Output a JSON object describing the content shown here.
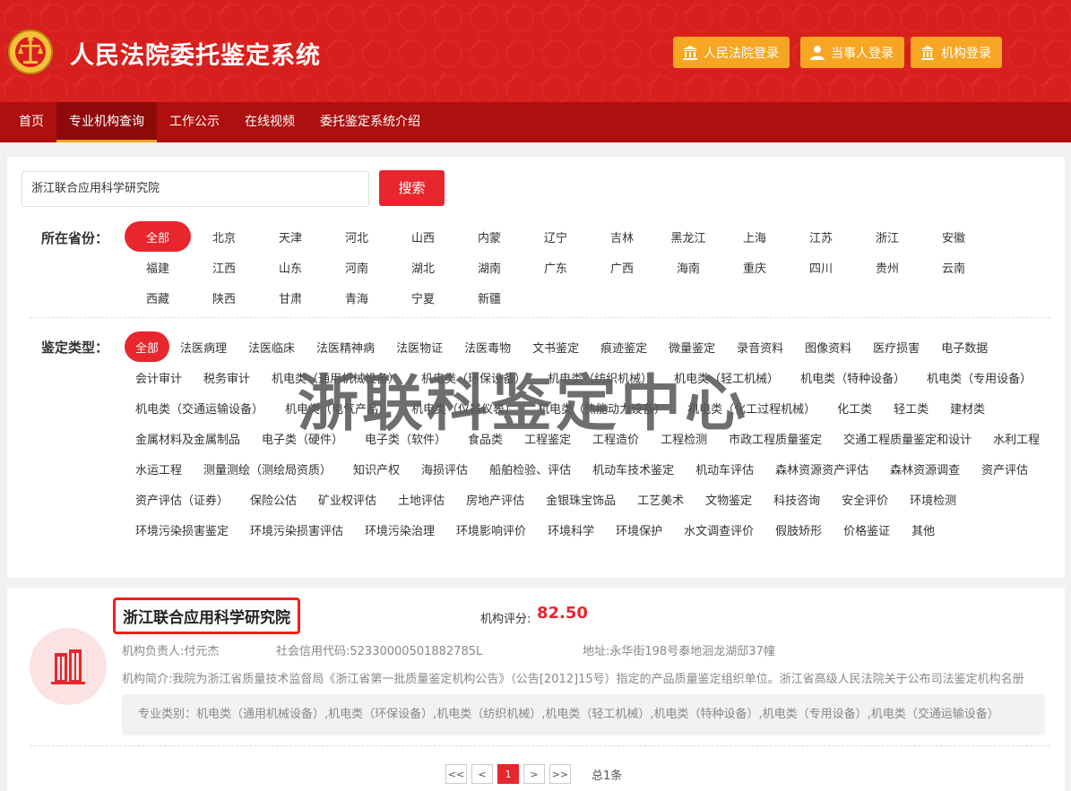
{
  "header": {
    "title": "人民法院委托鉴定系统",
    "logins": [
      "人民法院登录",
      "当事人登录",
      "机构登录"
    ]
  },
  "nav": {
    "items": [
      "首页",
      "专业机构查询",
      "工作公示",
      "在线视频",
      "委托鉴定系统介绍"
    ],
    "active_index": 1
  },
  "search": {
    "value": "浙江联合应用科学研究院",
    "button": "搜索"
  },
  "filters": {
    "province_label": "所在省份：",
    "provinces": [
      "全部",
      "北京",
      "天津",
      "河北",
      "山西",
      "内蒙",
      "辽宁",
      "吉林",
      "黑龙江",
      "上海",
      "江苏",
      "浙江",
      "安徽",
      "福建",
      "江西",
      "山东",
      "河南",
      "湖北",
      "湖南",
      "广东",
      "广西",
      "海南",
      "重庆",
      "四川",
      "贵州",
      "云南",
      "西藏",
      "陕西",
      "甘肃",
      "青海",
      "宁夏",
      "新疆"
    ],
    "type_label": "鉴定类型：",
    "types": [
      "全部",
      "法医病理",
      "法医临床",
      "法医精神病",
      "法医物证",
      "法医毒物",
      "文书鉴定",
      "痕迹鉴定",
      "微量鉴定",
      "录音资料",
      "图像资料",
      "医疗损害",
      "电子数据",
      "会计审计",
      "税务审计",
      "机电类（通用机械设备）",
      "机电类（环保设备）",
      "机电类（纺织机械）",
      "机电类（轻工机械）",
      "机电类（特种设备）",
      "机电类（专用设备）",
      "机电类（交通运输设备）",
      "机电类（电气产品）",
      "机电类（仪器仪表）",
      "机电类（热能动力设备）",
      "机电类（化工过程机械）",
      "化工类",
      "轻工类",
      "建材类",
      "金属材料及金属制品",
      "电子类（硬件）",
      "电子类（软件）",
      "食品类",
      "工程鉴定",
      "工程造价",
      "工程检测",
      "市政工程质量鉴定",
      "交通工程质量鉴定和设计",
      "水利工程",
      "水运工程",
      "测量测绘（测绘局资质）",
      "知识产权",
      "海损评估",
      "船舶检验、评估",
      "机动车技术鉴定",
      "机动车评估",
      "森林资源资产评估",
      "森林资源调查",
      "资产评估",
      "资产评估（证券）",
      "保险公估",
      "矿业权评估",
      "土地评估",
      "房地产评估",
      "金银珠宝饰品",
      "工艺美术",
      "文物鉴定",
      "科技咨询",
      "安全评价",
      "环境检测",
      "环境污染损害鉴定",
      "环境污染损害评估",
      "环境污染治理",
      "环境影响评价",
      "环境科学",
      "环境保护",
      "水文调查评价",
      "假肢矫形",
      "价格鉴证",
      "其他"
    ]
  },
  "result": {
    "name": "浙江联合应用科学研究院",
    "score_label": "机构评分:",
    "score": "82.50",
    "leader": "机构负责人:付元杰",
    "credit_code": "社会信用代码:52330000501882785L",
    "address": "地址:永华街198号泰地洄龙湖邸37幢",
    "intro": "机构简介:我院为浙江省质量技术监督局《浙江省第一批质量鉴定机构公告》（公告[2012]15号）指定的产品质量鉴定组织单位。浙江省高级人民法院关于公布司法鉴定机构名册",
    "categories": "专业类别：机电类（通用机械设备）,机电类（环保设备）,机电类（纺织机械）,机电类（轻工机械）,机电类（特种设备）,机电类（专用设备）,机电类（交通运输设备）"
  },
  "pager": {
    "first": "<<",
    "prev": "<",
    "current": "1",
    "next": ">",
    "last": ">>",
    "total": "总1条"
  },
  "watermark": "浙联科鉴定中心",
  "colors": {
    "brand_red": "#d7201d",
    "nav_red": "#ae0f0f",
    "accent_orange": "#f6a623",
    "active_red": "#e8262e"
  }
}
